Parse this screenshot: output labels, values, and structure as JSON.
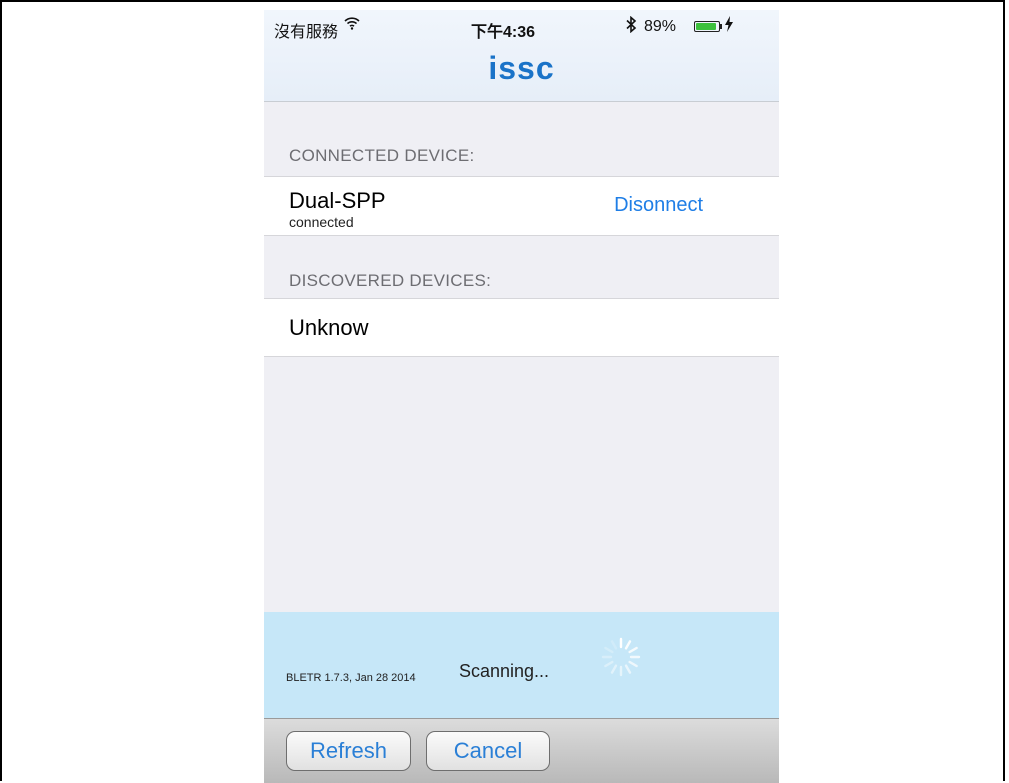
{
  "status_bar": {
    "carrier": "沒有服務",
    "wifi_icon": "wifi-icon",
    "time": "下午4:36",
    "bluetooth_icon": "bluetooth-icon",
    "battery_percent": "89%",
    "battery_level": 0.89
  },
  "header": {
    "logo": "issc"
  },
  "connected_section": {
    "label": "CONNECTED DEVICE:",
    "device": {
      "name": "Dual-SPP",
      "status": "connected",
      "action_label": "Disonnect"
    }
  },
  "discovered_section": {
    "label": "DISCOVERED DEVICES:",
    "devices": [
      {
        "name": "Unknow"
      }
    ]
  },
  "scan_panel": {
    "version": "BLETR 1.7.3, Jan 28 2014",
    "status": "Scanning...",
    "spinner_icon": "activity-spinner-icon"
  },
  "toolbar": {
    "refresh_label": "Refresh",
    "cancel_label": "Cancel"
  },
  "colors": {
    "accent": "#1f7ee6",
    "logo": "#1a73c8",
    "scan_bg": "#c6e7f8",
    "battery": "#3cc13c"
  }
}
